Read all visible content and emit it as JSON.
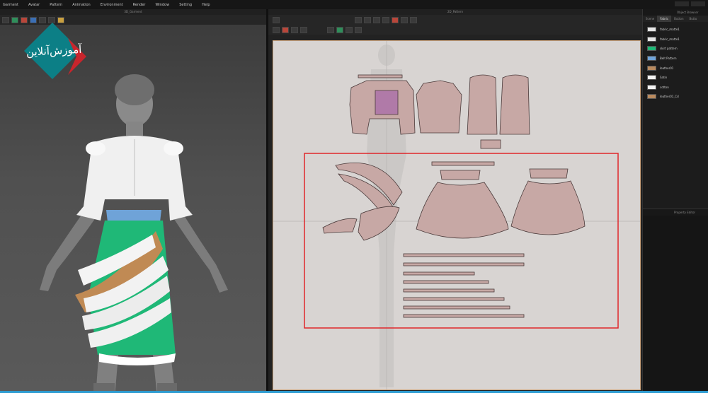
{
  "menu": [
    "Garment",
    "Avatar",
    "Pattern",
    "Animation",
    "Environment",
    "Render",
    "Window",
    "Setting",
    "Help"
  ],
  "viewports": {
    "left_title": "3D_Garment",
    "center_title": "2D_Pattern"
  },
  "logo": {
    "text": "آموزش‌آنلاین",
    "bg_color": "#0c7f86",
    "accent_color": "#c8252c"
  },
  "right_panel": {
    "title": "Object Browser",
    "tabs": [
      "Scene",
      "Fabric",
      "Button",
      "Butto"
    ],
    "active_tab": "Fabric",
    "fabrics": [
      {
        "name": "fabric_matte1",
        "color": "#e6e6e6"
      },
      {
        "name": "fabric_matte1",
        "color": "#e6e6e6"
      },
      {
        "name": "skirt pattern",
        "color": "#1fb877"
      },
      {
        "name": "Belt Pattern",
        "color": "#6fa3d8"
      },
      {
        "name": "leather01",
        "color": "#b98a5e"
      },
      {
        "name": "Satin",
        "color": "#f2f2f2"
      },
      {
        "name": "cotton",
        "color": "#f2f2f2"
      },
      {
        "name": "leather01_Cd",
        "color": "#b98a5e"
      }
    ],
    "property_editor_title": "Property Editor"
  },
  "colors": {
    "piece_fill": "#c7a8a5",
    "piece_stroke": "#4a3a3a",
    "selection_box": "#e0262a",
    "skirt_green": "#1fb877",
    "belt_blue": "#6fa3d8",
    "tan": "#c08a54"
  }
}
